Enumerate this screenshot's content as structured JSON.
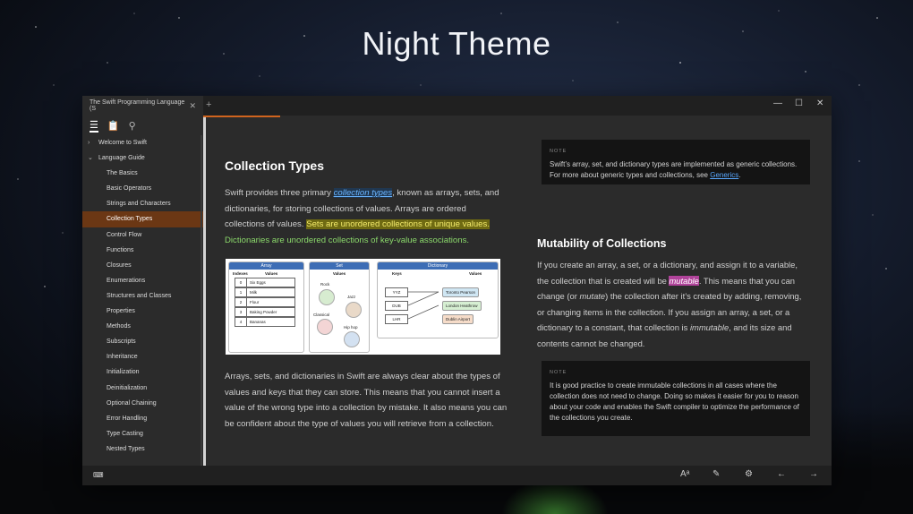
{
  "hero": {
    "title": "Night Theme"
  },
  "window": {
    "tab_title": "The Swift Programming Language (S",
    "tab_close": "✕",
    "new_tab": "+",
    "controls": {
      "minimize": "—",
      "maximize": "☐",
      "close": "✕"
    }
  },
  "sidebar": {
    "tools": {
      "toc": "☰",
      "bookmarks": "📋",
      "search": "⚲"
    },
    "items": [
      {
        "label": "Welcome to Swift",
        "level": 0,
        "chevron": "›"
      },
      {
        "label": "Language Guide",
        "level": 0,
        "chevron": "⌄"
      },
      {
        "label": "The Basics",
        "level": 1
      },
      {
        "label": "Basic Operators",
        "level": 1
      },
      {
        "label": "Strings and Characters",
        "level": 1
      },
      {
        "label": "Collection Types",
        "level": 1,
        "selected": true
      },
      {
        "label": "Control Flow",
        "level": 1
      },
      {
        "label": "Functions",
        "level": 1
      },
      {
        "label": "Closures",
        "level": 1
      },
      {
        "label": "Enumerations",
        "level": 1
      },
      {
        "label": "Structures and Classes",
        "level": 1
      },
      {
        "label": "Properties",
        "level": 1
      },
      {
        "label": "Methods",
        "level": 1
      },
      {
        "label": "Subscripts",
        "level": 1
      },
      {
        "label": "Inheritance",
        "level": 1
      },
      {
        "label": "Initialization",
        "level": 1
      },
      {
        "label": "Deinitialization",
        "level": 1
      },
      {
        "label": "Optional Chaining",
        "level": 1
      },
      {
        "label": "Error Handling",
        "level": 1
      },
      {
        "label": "Type Casting",
        "level": 1
      },
      {
        "label": "Nested Types",
        "level": 1
      }
    ],
    "bottom_icon": "⌨"
  },
  "content": {
    "heading1": "Collection Types",
    "p1": {
      "a": "Swift provides three primary ",
      "link": "collection types",
      "b": ", known as arrays, sets, and dictionaries, for storing collections of values. Arrays are ordered collections of values. ",
      "highlight": "Sets are unordered collections of unique values.",
      "green": "Dictionaries are unordered collections of key-value associations."
    },
    "diagram": {
      "array": {
        "title": "Array",
        "col1": "Indexes",
        "col2": "Values",
        "rows": [
          {
            "i": "0",
            "v": "Six Eggs"
          },
          {
            "i": "1",
            "v": "Milk"
          },
          {
            "i": "2",
            "v": "Flour"
          },
          {
            "i": "3",
            "v": "Baking Powder"
          },
          {
            "i": "4",
            "v": "Bananas"
          }
        ]
      },
      "set": {
        "title": "Set",
        "col": "Values",
        "items": [
          "Rock",
          "Jazz",
          "Classical",
          "Hip hop"
        ]
      },
      "dictionary": {
        "title": "Dictionary",
        "col1": "Keys",
        "col2": "Values",
        "rows": [
          {
            "k": "YYZ",
            "v": "Toronto Pearson"
          },
          {
            "k": "DUB",
            "v": "London Heathrow"
          },
          {
            "k": "LHR",
            "v": "Dublin Airport"
          }
        ]
      }
    },
    "p2": "Arrays, sets, and dictionaries in Swift are always clear about the types of values and keys that they can store. This means that you cannot insert a value of the wrong type into a collection by mistake. It also means you can be confident about the type of values you will retrieve from a collection.",
    "note1": {
      "label": "NOTE",
      "text": "Swift’s array, set, and dictionary types are implemented as generic collections. For more about generic types and collections, see ",
      "link": "Generics",
      "end": "."
    },
    "heading2": "Mutability of Collections",
    "p3": {
      "a": "If you create an array, a set, or a dictionary, and assign it to a variable, the collection that is created will be ",
      "pink": "mutable",
      "b": ". This means that you can change (or ",
      "mutate": "mutate",
      "c": ") the collection after it’s created by adding, removing, or changing items in the collection. If you assign an array, a set, or a dictionary to a constant, that collection is ",
      "immutable": "immutable",
      "d": ", and its size and contents cannot be changed."
    },
    "note2": {
      "label": "NOTE",
      "text": "It is good practice to create immutable collections in all cases where the collection does not need to change. Doing so makes it easier for you to reason about your code and enables the Swift compiler to optimize the performance of the collections you create."
    }
  },
  "bottombar": {
    "read_aloud": "A͏ᵃ",
    "highlight": "✎",
    "settings": "⚙",
    "back": "←",
    "forward": "→"
  },
  "colors": {
    "accent": "#d0641e",
    "selection": "#6b3714",
    "link": "#5aa9ff",
    "mark_yellow": "#6f6a12",
    "mark_pink": "#b0439a"
  }
}
